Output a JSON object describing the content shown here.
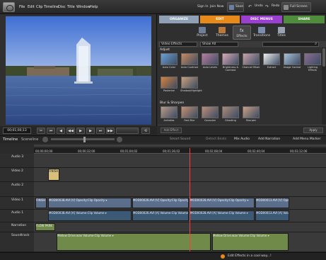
{
  "menu": {
    "items": [
      "File",
      "Edit",
      "Clip",
      "Timeline",
      "Disc",
      "Title",
      "Window",
      "Help"
    ],
    "right_links": [
      "Sign In",
      "Join Now"
    ],
    "save_label": "Save",
    "undo_label": "Undo",
    "redo_label": "Redo",
    "fullscreen_label": "Full Screen"
  },
  "monitor": {
    "timecode": "00;01;00;13"
  },
  "tasks": {
    "tabs": [
      {
        "label": "ORGANIZE",
        "color": "#8fa0b6"
      },
      {
        "label": "EDIT",
        "color": "#e88a1a"
      },
      {
        "label": "DISC MENUS",
        "color": "#9b3fd0"
      },
      {
        "label": "SHARE",
        "color": "#4f8c3b"
      }
    ],
    "subtabs": [
      "Project",
      "Themes",
      "Effects",
      "Transitions",
      "Titles"
    ],
    "active_subtab": "Effects"
  },
  "effects": {
    "category_dropdown": "Video Effects",
    "filter_dropdown": "Show All",
    "categories": [
      {
        "name": "Adjust",
        "items": [
          {
            "label": "Auto Color",
            "color": "#6aa0d6"
          },
          {
            "label": "Auto Contrast",
            "color": "#c98a5e"
          },
          {
            "label": "Auto Levels",
            "color": "#b77ea0"
          },
          {
            "label": "Brightness & Contrast",
            "color": "#d8a9b8"
          },
          {
            "label": "Channel Mixer",
            "color": "#c9a2a9"
          },
          {
            "label": "Extract",
            "color": "#eeeeee"
          },
          {
            "label": "Image Control",
            "color": "#a9c2d8"
          },
          {
            "label": "Lighting Effects",
            "color": "#8b6e92"
          },
          {
            "label": "Posterize",
            "color": "#d6813d"
          },
          {
            "label": "Shadow/Highlight",
            "color": "#caa07c"
          }
        ]
      },
      {
        "name": "Blur & Sharpen",
        "items": [
          {
            "label": "Antialias",
            "color": "#b79a86"
          },
          {
            "label": "Fast Blur",
            "color": "#c69070"
          },
          {
            "label": "Gaussian",
            "color": "#bb8d78"
          },
          {
            "label": "Ghosting",
            "color": "#a98a78"
          },
          {
            "label": "Sharpen",
            "color": "#c99f84"
          }
        ]
      }
    ],
    "add_effect_label": "Add Effect",
    "apply_label": "Apply"
  },
  "timeline": {
    "view_tabs": [
      "Timeline",
      "Sceneline"
    ],
    "tools": [
      "Smart Sound",
      "Detect Beats",
      "Mix Audio",
      "Add Narration",
      "Add Menu Marker"
    ],
    "ruler": [
      "00;00;00;00",
      "00;00;32;00",
      "00;01;04;02",
      "00;01;36;02",
      "00;02;08;04",
      "00;02;40;04",
      "00;03;12;06"
    ],
    "tracks": [
      {
        "name": "Audio 3",
        "type": "audio",
        "clips": []
      },
      {
        "name": "Video 2",
        "type": "video",
        "clips": [
          {
            "label": "FINISH",
            "start": 20,
            "width": 16,
            "kind": "title"
          }
        ]
      },
      {
        "name": "Audio 2",
        "type": "audio",
        "clips": []
      },
      {
        "name": "Video 1",
        "type": "video",
        "clips": [
          {
            "label": "FINISH",
            "start": 2,
            "width": 16,
            "kind": "v"
          },
          {
            "label": "MOD00038.AVI [V] Opacity:Clip Opacity ▾",
            "start": 20,
            "width": 118,
            "kind": "v"
          },
          {
            "label": "MOD00026.AVI [V] Opacity:Clip Opacity ▾",
            "start": 139,
            "width": 80,
            "kind": "v"
          },
          {
            "label": "MOD00028.AVI [V] Opacity:Clip Opacity ▾",
            "start": 220,
            "width": 92,
            "kind": "v"
          },
          {
            "label": "MOD00013.AVI [V] Opacit",
            "start": 313,
            "width": 48,
            "kind": "v"
          }
        ]
      },
      {
        "name": "Audio 1",
        "type": "audio",
        "clips": [
          {
            "label": "MOD00038.AVI [A] Volume:Clip Volume ▾",
            "start": 20,
            "width": 118,
            "kind": "a"
          },
          {
            "label": "MOD00026.AVI [A] Volume:Clip Volume ▾",
            "start": 139,
            "width": 80,
            "kind": "a"
          },
          {
            "label": "MOD00028.AVI [A] Volume:Clip Volume ▾",
            "start": 220,
            "width": 92,
            "kind": "a"
          },
          {
            "label": "MOD00013.AVI [A] Volu",
            "start": 313,
            "width": 48,
            "kind": "a"
          }
        ]
      },
      {
        "name": "Narration",
        "type": "audio",
        "clips": [
          {
            "label": "FLOW PARK",
            "start": 2,
            "width": 28,
            "kind": "s"
          }
        ]
      },
      {
        "name": "Soundtrack",
        "type": "audio",
        "clips": [
          {
            "label": "Mellow Drive.wav Volume:Clip Volume ▾",
            "start": 32,
            "width": 218,
            "kind": "s"
          },
          {
            "label": "Mellow Drive.wav Volume:Clip Volume ▾",
            "start": 252,
            "width": 108,
            "kind": "s"
          }
        ]
      }
    ]
  },
  "status": {
    "message": "Edit Effects in a cool way...!"
  }
}
